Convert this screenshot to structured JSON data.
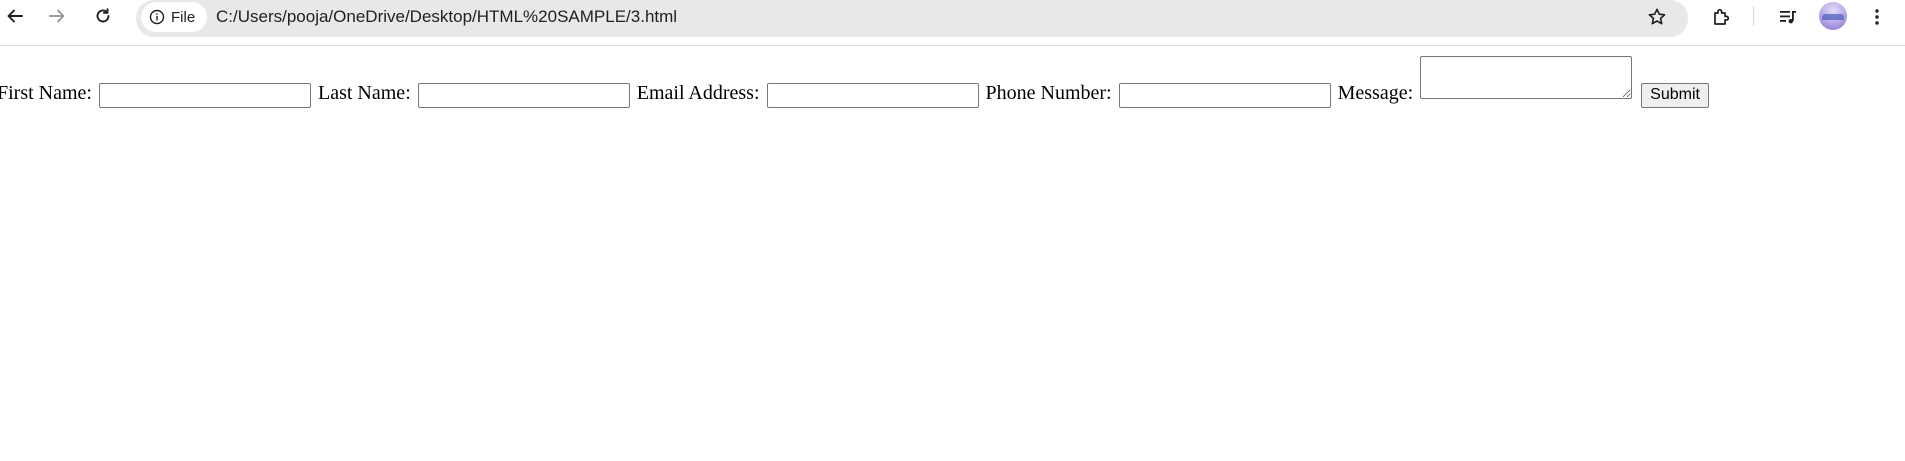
{
  "browser": {
    "address_bar": {
      "chip_label": "File",
      "url": "C:/Users/pooja/OneDrive/Desktop/HTML%20SAMPLE/3.html"
    },
    "icons": {
      "back": "arrow-left-icon",
      "forward": "arrow-right-icon",
      "reload": "reload-icon",
      "info": "info-icon",
      "bookmark": "star-icon",
      "extensions": "puzzle-icon",
      "media": "media-queue-icon",
      "menu": "three-dots-vertical-icon"
    }
  },
  "form": {
    "first_name_label": "First Name:",
    "first_name_value": "",
    "last_name_label": "Last Name:",
    "last_name_value": "",
    "email_label": "Email Address:",
    "email_value": "",
    "phone_label": "Phone Number:",
    "phone_value": "",
    "message_label": "Message:",
    "message_value": "",
    "submit_label": "Submit"
  }
}
